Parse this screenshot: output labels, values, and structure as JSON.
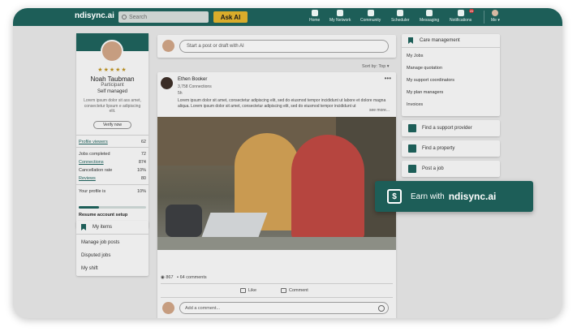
{
  "nav": {
    "brand": "ndisync.ai",
    "search_placeholder": "Search",
    "askai": "Ask AI",
    "items": [
      {
        "label": "Home",
        "icon": "home-icon"
      },
      {
        "label": "My Network",
        "icon": "network-icon"
      },
      {
        "label": "Community",
        "icon": "community-icon"
      },
      {
        "label": "Scheduler",
        "icon": "calendar-icon"
      },
      {
        "label": "Messaging",
        "icon": "message-icon"
      },
      {
        "label": "Notifications",
        "icon": "bell-icon",
        "badge": "20"
      },
      {
        "label": "Me ▾",
        "icon": "avatar"
      }
    ]
  },
  "profile": {
    "stars": "★★★★★",
    "name": "Noah Taubman",
    "role": "Participant",
    "management": "Self managed",
    "bio": "Lorem ipsum dolor sit ass amet, consectetur lipsum e adipiscing elit.",
    "verify": "Verify now",
    "stats": [
      {
        "label": "Profile viewers",
        "value": "62",
        "link": true
      },
      {
        "label": "Jobs completed",
        "value": "72",
        "link": false
      },
      {
        "label": "Connections",
        "value": "874",
        "link": true
      },
      {
        "label": "Cancellation rate",
        "value": "10%",
        "link": false
      },
      {
        "label": "Reviews",
        "value": "80",
        "link": true
      }
    ],
    "profile_is_label": "Your profile is",
    "profile_is_value": "10%",
    "profile_progress": 0.3,
    "resume": "Resume account setup"
  },
  "my_items": {
    "title": "My items",
    "items": [
      "Manage job posts",
      "Disputed jobs",
      "My shift"
    ]
  },
  "composer": {
    "placeholder": "Start a post or draft with AI"
  },
  "sort": "Sort by: Top ▾",
  "post": {
    "author": "Ethen Booker",
    "connections": "3,758 Connections",
    "time": "5h",
    "body": "Lorem ipsum dolor sit amet, consectetur adipiscing elit, sed do eiusmod tempor incididunt ut labore et dolore magna aliqua. Lorem ipsum dolor sit amet, consectetur adipiscing elit, sed do eiusmod tempor incididunt ut",
    "see_more": "see more...",
    "likes": "867",
    "comments": "64 comments",
    "like_label": "Like",
    "comment_label": "Comment",
    "comment_placeholder": "Add a comment..."
  },
  "care": {
    "title": "Care management",
    "items": [
      "My Jobs",
      "Manage quotation",
      "My support coordinators",
      "My plan managers",
      "Invoices"
    ]
  },
  "right_buttons": [
    "Find a support provider",
    "Find a property",
    "Post a job"
  ],
  "earn": {
    "prefix": "Earn with",
    "brand": "ndisync.ai",
    "icon": "$"
  }
}
